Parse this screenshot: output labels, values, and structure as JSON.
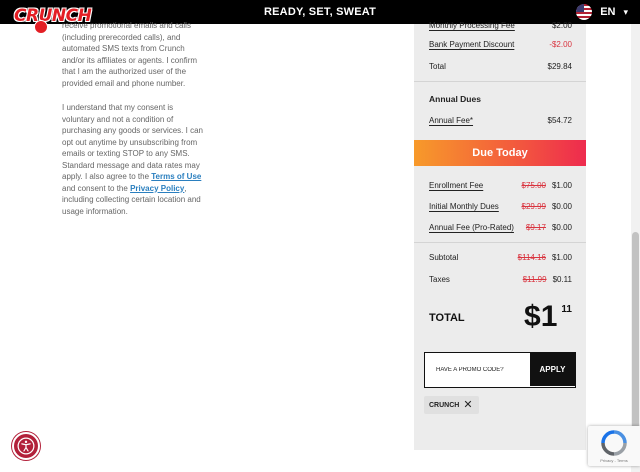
{
  "header": {
    "logo_text": "CRUNCH",
    "tagline": "READY, SET, SWEAT",
    "language": "EN"
  },
  "consent": {
    "p1": "receive promotional emails and calls (including prerecorded calls), and automated SMS texts from Crunch and/or its affiliates or agents. I confirm that I am the authorized user of the provided email and phone number.",
    "p2_before": "I understand that my consent is voluntary and not a condition of purchasing any goods or services. I can opt out anytime by unsubscribing from emails or texting STOP to any SMS. Standard message and data rates may apply. I also agree to the ",
    "terms_link": "Terms of Use",
    "p2_middle": " and consent to the ",
    "privacy_link": "Privacy Policy",
    "p2_after": ", including collecting certain location and usage information."
  },
  "summary": {
    "monthly_processing_fee": {
      "label": "Monthly Processing Fee",
      "value": "$2.00"
    },
    "bank_discount": {
      "label": "Bank Payment Discount",
      "value": "-$2.00"
    },
    "total": {
      "label": "Total",
      "value": "$29.84"
    },
    "annual_dues": {
      "title": "Annual Dues",
      "annual_fee": {
        "label": "Annual Fee*",
        "value": "$54.72"
      }
    },
    "due_today": {
      "title": "Due Today",
      "rows": [
        {
          "label": "Enrollment Fee",
          "original": "$75.00",
          "value": "$1.00"
        },
        {
          "label": "Initial Monthly Dues",
          "original": "$29.99",
          "value": "$0.00"
        },
        {
          "label": "Annual Fee (Pro-Rated)",
          "original": "$9.17",
          "value": "$0.00"
        }
      ],
      "subtotal": {
        "label": "Subtotal",
        "original": "$114.16",
        "value": "$1.00"
      },
      "taxes": {
        "label": "Taxes",
        "original": "$11.99",
        "value": "$0.11"
      },
      "grand_total": {
        "label": "TOTAL",
        "dollars": "$1",
        "cents": "11"
      }
    },
    "promo": {
      "placeholder": "HAVE A PROMO CODE?",
      "apply_label": "APPLY",
      "applied_code": "CRUNCH"
    }
  },
  "recaptcha": {
    "terms": "Privacy - Terms"
  },
  "colors": {
    "brand_red": "#e31e24",
    "strike_red": "#d9343f",
    "banner_start": "#f79a2a",
    "banner_end": "#ee2b4e"
  },
  "icons": {
    "logo": "crunch-logo",
    "flag": "us-flag-icon",
    "language_chevron": "chevron-down-icon",
    "remove_code": "close-icon",
    "accessibility": "accessibility-icon",
    "recaptcha": "recaptcha-icon"
  }
}
